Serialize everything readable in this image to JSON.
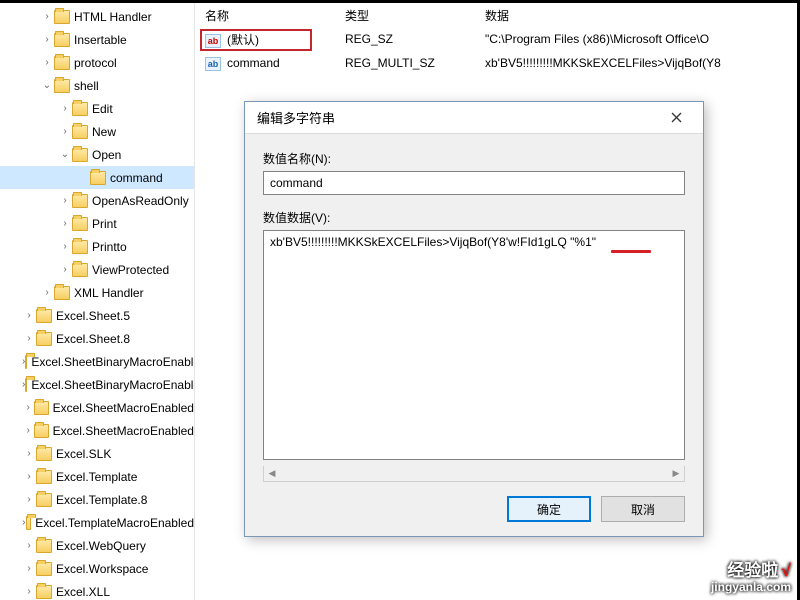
{
  "tree": {
    "items": [
      {
        "label": "HTML Handler",
        "indent": 2,
        "twisty": ">"
      },
      {
        "label": "Insertable",
        "indent": 2,
        "twisty": ">"
      },
      {
        "label": "protocol",
        "indent": 2,
        "twisty": ">"
      },
      {
        "label": "shell",
        "indent": 2,
        "twisty": "v"
      },
      {
        "label": "Edit",
        "indent": 3,
        "twisty": ">"
      },
      {
        "label": "New",
        "indent": 3,
        "twisty": ">"
      },
      {
        "label": "Open",
        "indent": 3,
        "twisty": "v"
      },
      {
        "label": "command",
        "indent": 4,
        "twisty": "",
        "selected": true
      },
      {
        "label": "OpenAsReadOnly",
        "indent": 3,
        "twisty": ">"
      },
      {
        "label": "Print",
        "indent": 3,
        "twisty": ">"
      },
      {
        "label": "Printto",
        "indent": 3,
        "twisty": ">"
      },
      {
        "label": "ViewProtected",
        "indent": 3,
        "twisty": ">"
      },
      {
        "label": "XML Handler",
        "indent": 2,
        "twisty": ">"
      },
      {
        "label": "Excel.Sheet.5",
        "indent": 1,
        "twisty": ">"
      },
      {
        "label": "Excel.Sheet.8",
        "indent": 1,
        "twisty": ">"
      },
      {
        "label": "Excel.SheetBinaryMacroEnabled",
        "indent": 1,
        "twisty": ">"
      },
      {
        "label": "Excel.SheetBinaryMacroEnabled",
        "indent": 1,
        "twisty": ">"
      },
      {
        "label": "Excel.SheetMacroEnabled",
        "indent": 1,
        "twisty": ">"
      },
      {
        "label": "Excel.SheetMacroEnabled",
        "indent": 1,
        "twisty": ">"
      },
      {
        "label": "Excel.SLK",
        "indent": 1,
        "twisty": ">"
      },
      {
        "label": "Excel.Template",
        "indent": 1,
        "twisty": ">"
      },
      {
        "label": "Excel.Template.8",
        "indent": 1,
        "twisty": ">"
      },
      {
        "label": "Excel.TemplateMacroEnabled",
        "indent": 1,
        "twisty": ">"
      },
      {
        "label": "Excel.WebQuery",
        "indent": 1,
        "twisty": ">"
      },
      {
        "label": "Excel.Workspace",
        "indent": 1,
        "twisty": ">"
      },
      {
        "label": "Excel.XLL",
        "indent": 1,
        "twisty": ">"
      }
    ]
  },
  "list": {
    "headers": {
      "name": "名称",
      "type": "类型",
      "data": "数据"
    },
    "rows": [
      {
        "icon": "ab",
        "name": "(默认)",
        "type": "REG_SZ",
        "data": "\"C:\\Program Files (x86)\\Microsoft Office\\O"
      },
      {
        "icon": "ab-blue",
        "name": "command",
        "type": "REG_MULTI_SZ",
        "data": "xb'BV5!!!!!!!!!MKKSkEXCELFiles>VijqBof(Y8"
      }
    ]
  },
  "dialog": {
    "title": "编辑多字符串",
    "name_label": "数值名称(N):",
    "name_value": "command",
    "value_label": "数值数据(V):",
    "value_text": "xb'BV5!!!!!!!!!MKKSkEXCELFiles>VijqBof(Y8'w!FId1gLQ \"%1\"",
    "ok": "确定",
    "cancel": "取消"
  },
  "watermark": {
    "brand": "经验啦",
    "check": "√",
    "url": "jingyanla.com"
  }
}
